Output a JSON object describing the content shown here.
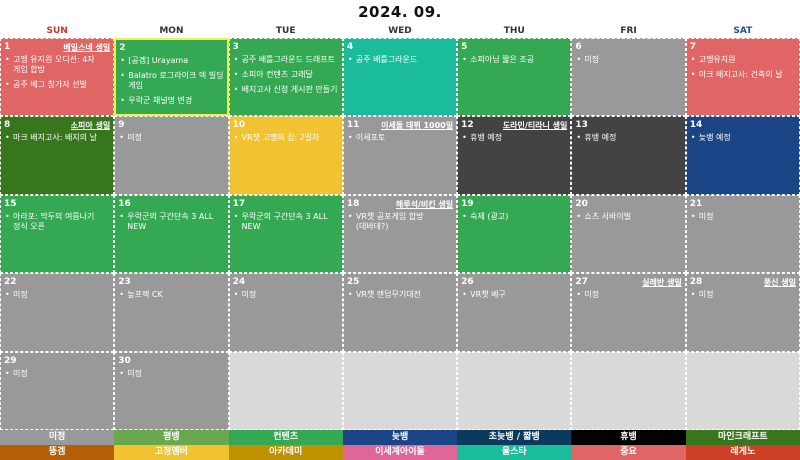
{
  "title": "2024. 09.",
  "weekdays": [
    {
      "label": "SUN",
      "color": "#c0392b"
    },
    {
      "label": "MON",
      "color": "#333333"
    },
    {
      "label": "TUE",
      "color": "#333333"
    },
    {
      "label": "WED",
      "color": "#333333"
    },
    {
      "label": "THU",
      "color": "#333333"
    },
    {
      "label": "FRI",
      "color": "#333333"
    },
    {
      "label": "SAT",
      "color": "#1f4e9c"
    }
  ],
  "days": [
    {
      "day": "1",
      "birthday": "베일스네 생일",
      "color": "#e06666",
      "events": [
        "고멩 유지원 오디션: 4자 게임 합방",
        "공주 베그 참가자 선발"
      ]
    },
    {
      "day": "2",
      "birthday": "",
      "color": "#34a853",
      "selected": true,
      "events": [
        "[공겜] Urayama",
        "Balatro 로그라이크 덱 빌딩 게임",
        "우락군 채널명 변경"
      ]
    },
    {
      "day": "3",
      "birthday": "",
      "color": "#34a853",
      "events": [
        "공주 배틀그라운드 드래프트",
        "소피아 컨텐츠 고래달",
        "배지고사 신청 게시판 만들기"
      ]
    },
    {
      "day": "4",
      "birthday": "",
      "color": "#1abc9c",
      "events": [
        "공주 배틀그라운드"
      ]
    },
    {
      "day": "5",
      "birthday": "",
      "color": "#34a853",
      "events": [
        "소피아님 짧은 조공"
      ]
    },
    {
      "day": "6",
      "birthday": "",
      "color": "#999999",
      "events": [
        "미정"
      ]
    },
    {
      "day": "7",
      "birthday": "",
      "color": "#e06666",
      "events": [
        "고멩유지원",
        "마크 배지고사: 건축의 날"
      ]
    },
    {
      "day": "8",
      "birthday": "소피아 생일",
      "color": "#38761d",
      "events": [
        "마크 배지고사: 배지의 날"
      ]
    },
    {
      "day": "9",
      "birthday": "",
      "color": "#999999",
      "events": [
        "미정"
      ]
    },
    {
      "day": "10",
      "birthday": "",
      "color": "#f1c232",
      "events": [
        "VR챗 고멩의 집: 2일차"
      ]
    },
    {
      "day": "11",
      "birthday": "이세돌 데뷔 1000일",
      "color": "#999999",
      "events": [
        "이세포토"
      ]
    },
    {
      "day": "12",
      "birthday": "도라민/티라니 생일",
      "color": "#434343",
      "events": [
        "휴뱅 예정"
      ]
    },
    {
      "day": "13",
      "birthday": "",
      "color": "#434343",
      "events": [
        "휴뱅 예정"
      ]
    },
    {
      "day": "14",
      "birthday": "",
      "color": "#1c4587",
      "events": [
        "늦뱅 예정"
      ]
    },
    {
      "day": "15",
      "birthday": "",
      "color": "#34a853",
      "events": [
        "아라포: 막두의 여름나기 정식 오픈"
      ]
    },
    {
      "day": "16",
      "birthday": "",
      "color": "#34a853",
      "events": [
        "우락군의 구간단속 3 ALL NEW"
      ]
    },
    {
      "day": "17",
      "birthday": "",
      "color": "#34a853",
      "events": [
        "우락군의 구간단속 3 ALL NEW"
      ]
    },
    {
      "day": "18",
      "birthday": "해루석/비킨 생일",
      "color": "#999999",
      "events": [
        "VR챗 공포게임 합방 (데바데?)"
      ]
    },
    {
      "day": "19",
      "birthday": "",
      "color": "#34a853",
      "events": [
        "숙제 (광고)"
      ]
    },
    {
      "day": "20",
      "birthday": "",
      "color": "#999999",
      "events": [
        "쇼츠 서바이벌"
      ]
    },
    {
      "day": "21",
      "birthday": "",
      "color": "#999999",
      "events": [
        "미정"
      ]
    },
    {
      "day": "22",
      "birthday": "",
      "color": "#999999",
      "events": [
        "미정"
      ]
    },
    {
      "day": "23",
      "birthday": "",
      "color": "#999999",
      "events": [
        "늪프랙 CK"
      ]
    },
    {
      "day": "24",
      "birthday": "",
      "color": "#999999",
      "events": [
        "미정"
      ]
    },
    {
      "day": "25",
      "birthday": "",
      "color": "#999999",
      "events": [
        "VR챗 랜덤무기대전"
      ]
    },
    {
      "day": "26",
      "birthday": "",
      "color": "#999999",
      "events": [
        "VR챗 베구"
      ]
    },
    {
      "day": "27",
      "birthday": "실레반 생일",
      "color": "#999999",
      "events": [
        "미정"
      ]
    },
    {
      "day": "28",
      "birthday": "풍신 생일",
      "color": "#999999",
      "events": [
        "미정"
      ]
    },
    {
      "day": "29",
      "birthday": "",
      "color": "#999999",
      "events": [
        "미정"
      ]
    },
    {
      "day": "30",
      "birthday": "",
      "color": "#999999",
      "events": [
        "미정"
      ]
    }
  ],
  "legend_row1": [
    {
      "label": "미정",
      "color": "#999999"
    },
    {
      "label": "평뱅",
      "color": "#6aa84f"
    },
    {
      "label": "컨텐츠",
      "color": "#34a853"
    },
    {
      "label": "늦뱅",
      "color": "#1c4587"
    },
    {
      "label": "초늦뱅 / 짧뱅",
      "color": "#0b3a5c"
    },
    {
      "label": "휴뱅",
      "color": "#000000"
    },
    {
      "label": "마인크래프트",
      "color": "#38761d"
    }
  ],
  "legend_row2": [
    {
      "label": "뚱겜",
      "color": "#b45f06"
    },
    {
      "label": "고정멤버",
      "color": "#f1c232"
    },
    {
      "label": "아카데미",
      "color": "#bf9000"
    },
    {
      "label": "이세계아이돌",
      "color": "#e06699"
    },
    {
      "label": "울스타",
      "color": "#1abc9c"
    },
    {
      "label": "중요",
      "color": "#e06666"
    },
    {
      "label": "레게노",
      "color": "#cc4125"
    }
  ]
}
